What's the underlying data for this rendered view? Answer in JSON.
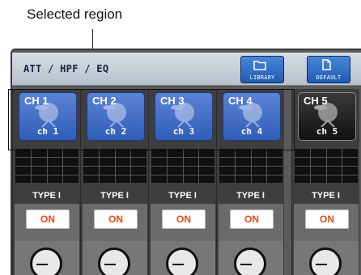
{
  "callout": {
    "text": "Selected region"
  },
  "screen": {
    "title": "ATT / HPF / EQ",
    "library_label": "LIBRARY",
    "default_label": "DEFAULT"
  },
  "channels": [
    {
      "id": "CH 1",
      "name": "ch 1",
      "eq_type": "TYPE I",
      "on_label": "ON",
      "selected": true
    },
    {
      "id": "CH 2",
      "name": "ch 2",
      "eq_type": "TYPE I",
      "on_label": "ON",
      "selected": true
    },
    {
      "id": "CH 3",
      "name": "ch 3",
      "eq_type": "TYPE I",
      "on_label": "ON",
      "selected": true
    },
    {
      "id": "CH 4",
      "name": "ch 4",
      "eq_type": "TYPE I",
      "on_label": "ON",
      "selected": true
    },
    {
      "id": "CH 5",
      "name": "ch 5",
      "eq_type": "TYPE I",
      "on_label": "ON",
      "selected": false
    }
  ],
  "colors": {
    "accent_blue": "#2f5db8",
    "on_text": "#f04a15"
  }
}
